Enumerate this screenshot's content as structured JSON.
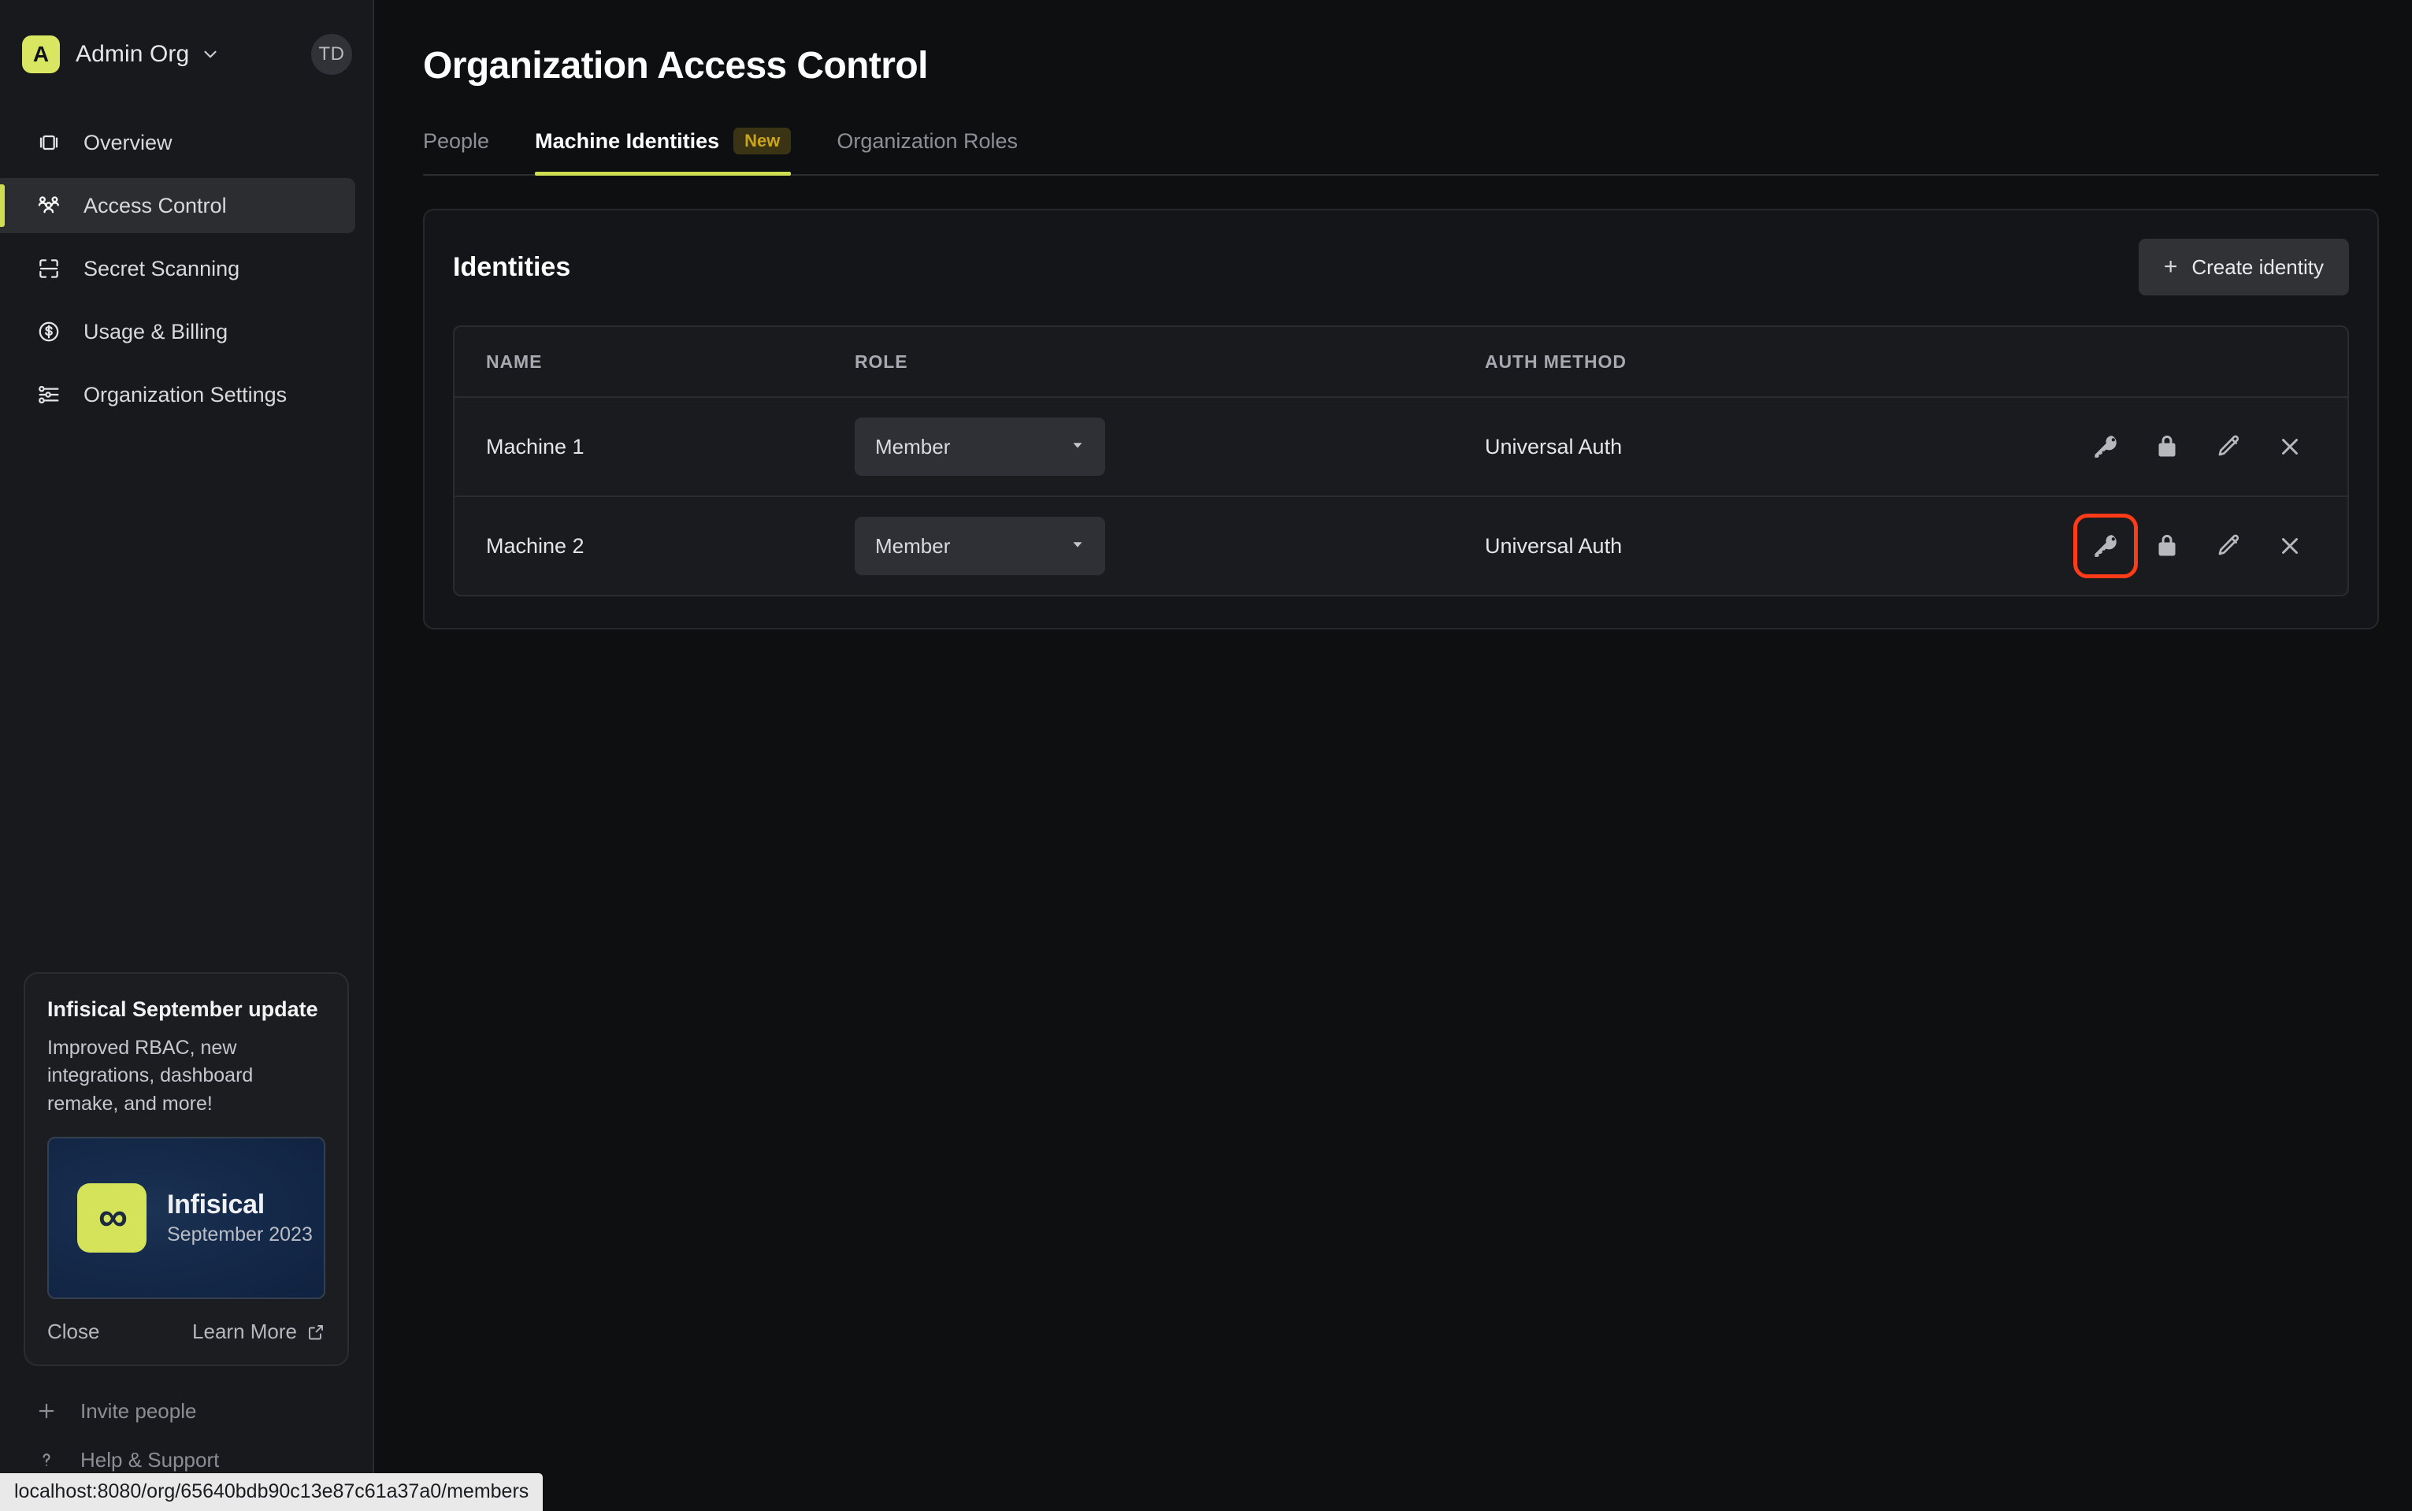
{
  "sidebar": {
    "org": {
      "avatar_letter": "A",
      "name": "Admin Org",
      "avatar_color": "#d9e662"
    },
    "user": {
      "initials": "TD"
    },
    "items": [
      {
        "label": "Overview",
        "icon": "layers-icon",
        "active": false
      },
      {
        "label": "Access Control",
        "icon": "users-group-icon",
        "active": true
      },
      {
        "label": "Secret Scanning",
        "icon": "scan-frame-icon",
        "active": false
      },
      {
        "label": "Usage & Billing",
        "icon": "dollar-circle-icon",
        "active": false
      },
      {
        "label": "Organization Settings",
        "icon": "sliders-icon",
        "active": false
      }
    ],
    "newsletter": {
      "title": "Infisical September update",
      "body": "Improved RBAC, new integrations, dashboard remake, and more!",
      "banner_brand": "Infisical",
      "banner_date": "September 2023",
      "close_label": "Close",
      "learn_more_label": "Learn More"
    },
    "footer": [
      {
        "label": "Invite people",
        "icon": "plus-icon"
      },
      {
        "label": "Help & Support",
        "icon": "question-icon"
      }
    ]
  },
  "main": {
    "page_title": "Organization Access Control",
    "tabs": [
      {
        "label": "People",
        "active": false,
        "badge": null
      },
      {
        "label": "Machine Identities",
        "active": true,
        "badge": "New"
      },
      {
        "label": "Organization Roles",
        "active": false,
        "badge": null
      }
    ],
    "panel": {
      "title": "Identities",
      "create_button": "Create identity",
      "table": {
        "columns": [
          "NAME",
          "ROLE",
          "AUTH METHOD",
          ""
        ],
        "rows": [
          {
            "name": "Machine 1",
            "role": "Member",
            "auth_method": "Universal Auth",
            "actions": [
              "key-icon",
              "lock-icon",
              "pencil-icon",
              "close-x-icon"
            ],
            "highlighted_action": null
          },
          {
            "name": "Machine 2",
            "role": "Member",
            "auth_method": "Universal Auth",
            "actions": [
              "key-icon",
              "lock-icon",
              "pencil-icon",
              "close-x-icon"
            ],
            "highlighted_action": "key-icon"
          }
        ]
      }
    }
  },
  "statusbar": {
    "url": "localhost:8080/org/65640bdb90c13e87c61a37a0/members"
  },
  "colors": {
    "accent": "#cddf51",
    "badge_text": "#cba418",
    "badge_bg": "#3a3414",
    "highlight": "#ff3b18",
    "page_bg": "#0e0f11",
    "sidebar_bg": "#18191c"
  }
}
